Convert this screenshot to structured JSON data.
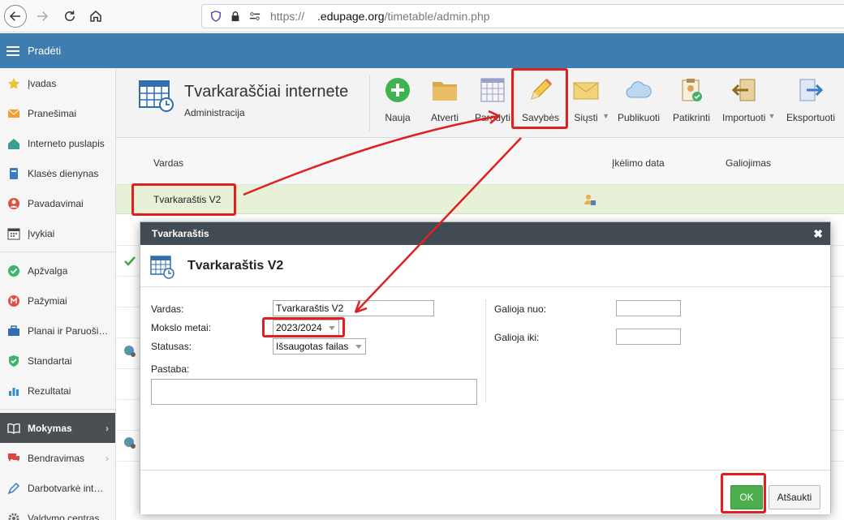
{
  "browser": {
    "url_scheme": "https://",
    "url_host": ".edupage.org",
    "url_path": "/timetable/admin.php"
  },
  "app": {
    "menu_title": "Pradėti"
  },
  "sidebar": {
    "items": [
      {
        "label": "Įvadas",
        "icon": "star-icon"
      },
      {
        "label": "Pranešimai",
        "icon": "envelope-icon"
      },
      {
        "label": "Interneto puslapis",
        "icon": "home-icon"
      },
      {
        "label": "Klasės dienynas",
        "icon": "book-icon"
      },
      {
        "label": "Pavadavimai",
        "icon": "person-icon"
      },
      {
        "label": "Įvykiai",
        "icon": "calendar-icon"
      },
      {
        "label": "Apžvalga",
        "icon": "check-circle-icon"
      },
      {
        "label": "Pažymiai",
        "icon": "grade-icon"
      },
      {
        "label": "Planai ir Paruošimai",
        "icon": "briefcase-icon"
      },
      {
        "label": "Standartai",
        "icon": "shield-check-icon"
      },
      {
        "label": "Rezultatai",
        "icon": "bar-chart-icon"
      },
      {
        "label": "Mokymas",
        "icon": "open-book-icon",
        "active": true
      },
      {
        "label": "Bendravimas",
        "icon": "chat-icon"
      },
      {
        "label": "Darbotvarkė internete",
        "icon": "pencil-icon"
      },
      {
        "label": "Valdymo centras",
        "icon": "gear-icon"
      }
    ]
  },
  "header": {
    "title": "Tvarkaraščiai internete",
    "subtitle": "Administracija"
  },
  "toolbar": {
    "nauja": "Nauja",
    "atverti": "Atverti",
    "parodyti": "Parodyti",
    "savybes": "Savybės",
    "siusti": "Siųsti",
    "publikuoti": "Publikuoti",
    "patikrinti": "Patikrinti",
    "importuoti": "Importuoti",
    "eksportuoti": "Eksportuoti"
  },
  "table": {
    "columns": {
      "name": "Vardas",
      "upload_date": "Įkėlimo data",
      "validity": "Galiojimas"
    },
    "selected_row_name": "Tvarkaraštis V2"
  },
  "dialog": {
    "window_title": "Tvarkaraštis",
    "heading": "Tvarkaraštis V2",
    "fields": {
      "name_label": "Vardas:",
      "name_value": "Tvarkaraštis V2",
      "school_year_label": "Mokslo metai:",
      "school_year_value": "2023/2024",
      "status_label": "Statusas:",
      "status_value": "Išsaugotas failas",
      "note_label": "Pastaba:",
      "valid_from_label": "Galioja nuo:",
      "valid_to_label": "Galioja iki:"
    },
    "ok_label": "OK",
    "cancel_label": "Atšaukti"
  },
  "colors": {
    "app_bar": "#3f7db1",
    "sidebar_active": "#4b4f54",
    "selected_row": "#e7f1d8",
    "dialog_title": "#414b53",
    "ok_button": "#4cae4c",
    "annotation_red": "#e02020"
  }
}
